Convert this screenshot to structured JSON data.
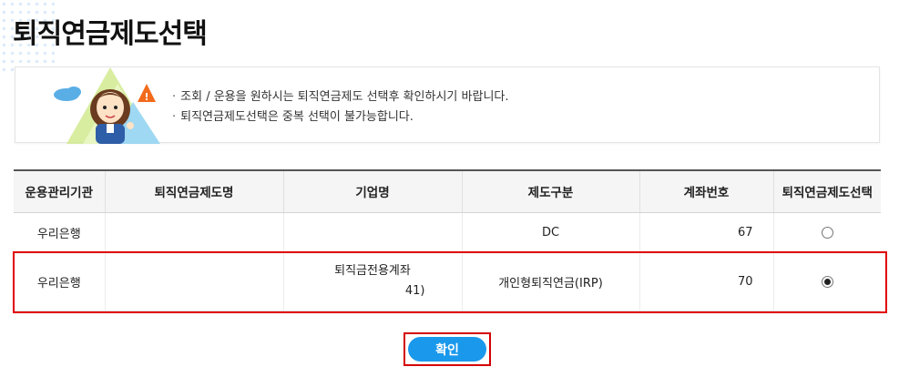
{
  "page": {
    "title": "퇴직연금제도선택"
  },
  "notice": {
    "lines": [
      "조회 / 운용을 원하시는 퇴직연금제도 선택후 확인하시기 바랍니다.",
      "퇴직연금제도선택은 중복 선택이 불가능합니다."
    ]
  },
  "table": {
    "headers": [
      "운용관리기관",
      "퇴직연금제도명",
      "기업명",
      "제도구분",
      "계좌번호",
      "퇴직연금제도선택"
    ],
    "rows": [
      {
        "institution": "우리은행",
        "plan_name": "",
        "company": "",
        "company_sub": "",
        "type": "DC",
        "account": "67",
        "selected": false
      },
      {
        "institution": "우리은행",
        "plan_name": "",
        "company": "퇴직금전용계좌",
        "company_sub": "41)",
        "type": "개인형퇴직연금(IRP)",
        "account": "70",
        "selected": true
      }
    ]
  },
  "actions": {
    "confirm_label": "확인"
  },
  "colors": {
    "accent": "#1a98ec",
    "highlight": "#e00000"
  }
}
